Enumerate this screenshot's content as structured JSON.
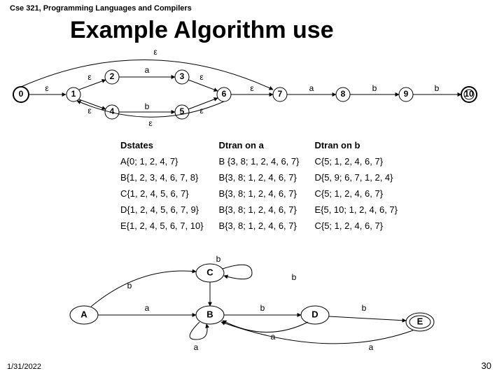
{
  "header": "Cse 321, Programming Languages and Compilers",
  "title": "Example Algorithm use",
  "date": "1/31/2022",
  "page": "30",
  "epsilon": "ε",
  "nfa": {
    "nodes": [
      "0",
      "1",
      "2",
      "3",
      "4",
      "5",
      "6",
      "7",
      "8",
      "9",
      "10"
    ],
    "edge_a1": "a",
    "edge_a2": "a",
    "edge_b1": "b",
    "edge_b2": "b",
    "edge_b3": "b"
  },
  "table": {
    "h1": "Dstates",
    "h2": "Dtran on a",
    "h3": "Dtran on b",
    "rows": [
      [
        "A{0; 1, 2, 4, 7}",
        "B {3, 8; 1, 2, 4, 6, 7}",
        "C{5; 1, 2, 4, 6, 7}"
      ],
      [
        "B{1, 2, 3, 4, 6, 7, 8}",
        "B{3, 8; 1, 2, 4, 6, 7}",
        "D{5, 9; 6, 7, 1, 2, 4}"
      ],
      [
        "C{1, 2, 4, 5, 6, 7}",
        "B{3, 8; 1, 2, 4, 6, 7}",
        "C{5; 1, 2, 4, 6, 7}"
      ],
      [
        "D{1, 2, 4, 5, 6, 7, 9}",
        "B{3, 8; 1, 2, 4, 6, 7}",
        "E{5, 10; 1, 2, 4, 6, 7}"
      ],
      [
        "E{1, 2, 4, 5, 6, 7, 10}",
        "B{3, 8; 1, 2, 4, 6, 7}",
        "C{5; 1, 2, 4, 6, 7}"
      ]
    ]
  },
  "dfa": {
    "nodes": [
      "A",
      "B",
      "C",
      "D",
      "E"
    ],
    "l_ab": "a",
    "l_ac": "b",
    "l_bd": "b",
    "l_de": "b",
    "l_bb": "a",
    "l_cb": "b",
    "l_da": "a",
    "l_ea": "a",
    "l_cc_b": "b"
  }
}
